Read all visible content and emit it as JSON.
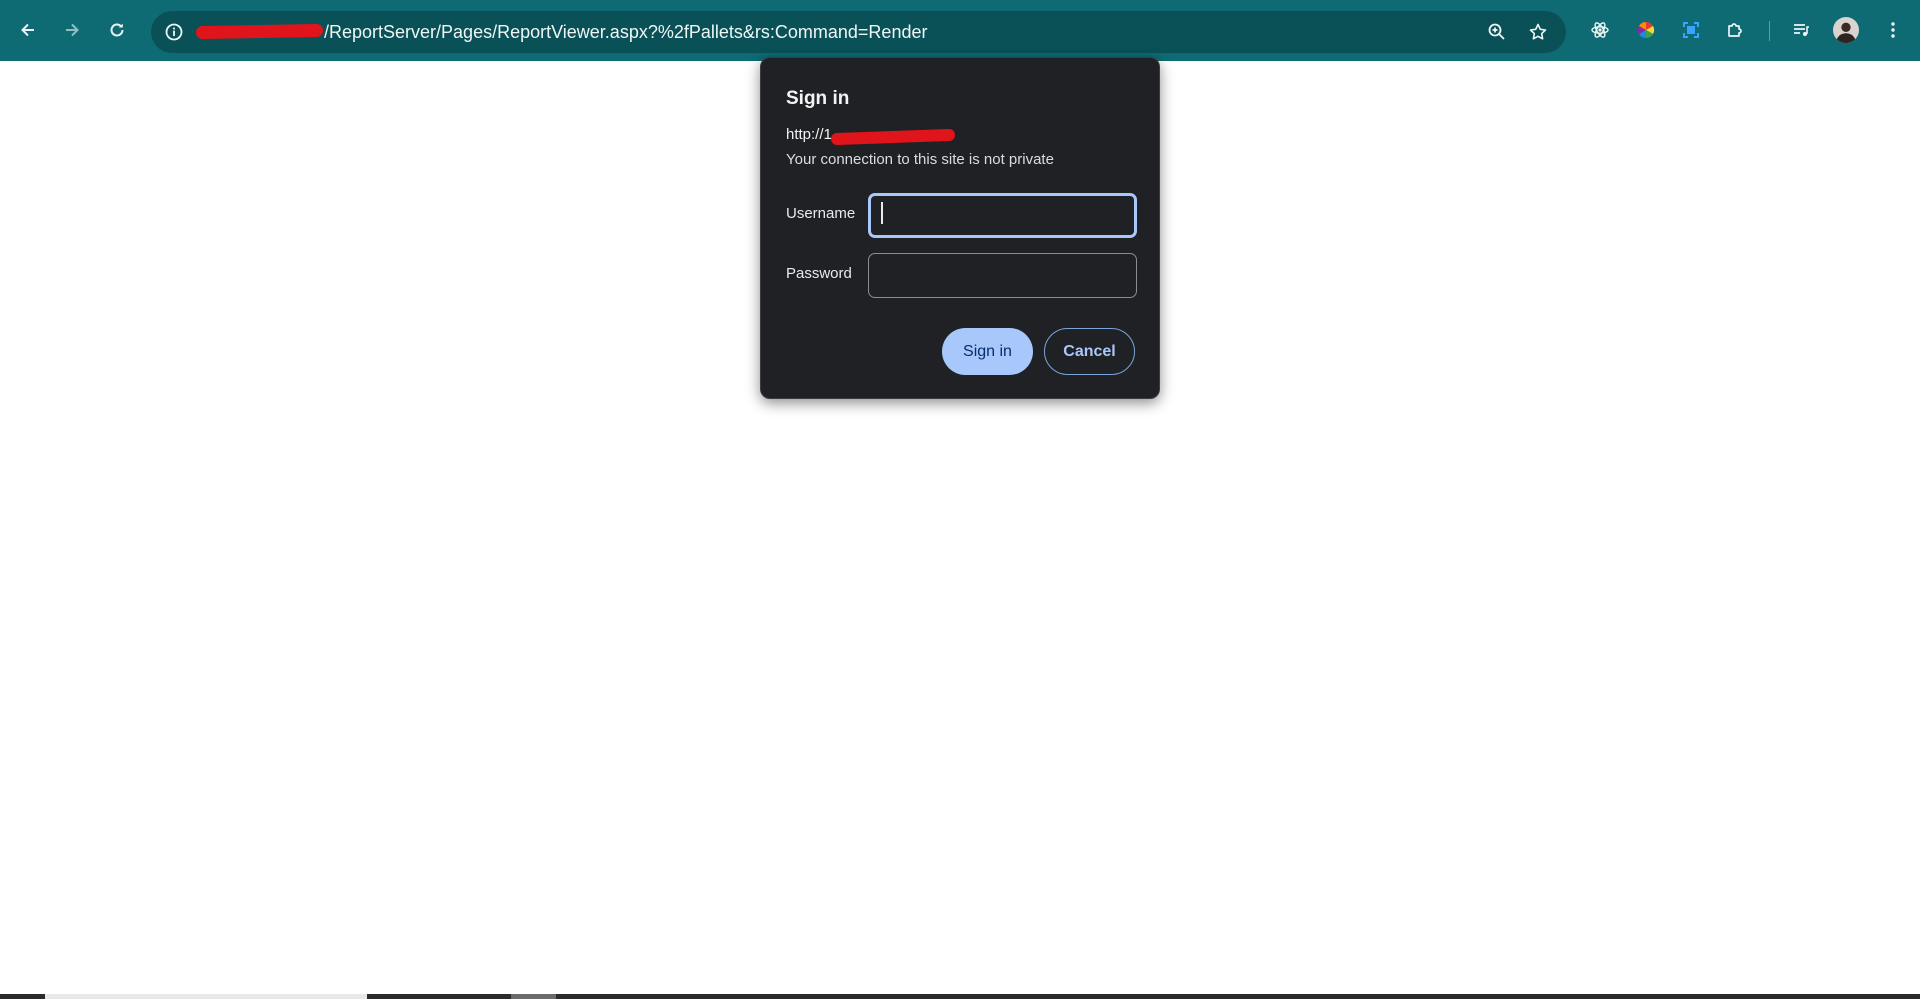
{
  "browser": {
    "nav": {
      "back_icon": "arrow-left-icon",
      "forward_icon": "arrow-right-icon",
      "reload_icon": "reload-icon"
    },
    "omnibox": {
      "info_icon": "info-icon",
      "url_visible": "/ReportServer/Pages/ReportViewer.aspx?%2fPallets&rs:Command=Render",
      "zoom_icon": "zoom-icon",
      "bookmark_icon": "star-icon"
    },
    "extensions": [
      "react-devtools-icon",
      "color-picker-icon",
      "screenshot-icon",
      "extensions-puzzle-icon"
    ],
    "media_icon": "media-queue-icon",
    "profile_icon": "avatar",
    "menu_icon": "kebab-menu-icon",
    "colors": {
      "toolbar": "#0e6b73",
      "omnibox": "#0a5157"
    }
  },
  "dialog": {
    "title": "Sign in",
    "origin": "http://1",
    "warning": "Your connection to this site is not private",
    "username_label": "Username",
    "username_value": "",
    "password_label": "Password",
    "password_value": "",
    "signin_label": "Sign in",
    "cancel_label": "Cancel",
    "colors": {
      "background": "#202124",
      "primary": "#a8c7fa"
    }
  }
}
